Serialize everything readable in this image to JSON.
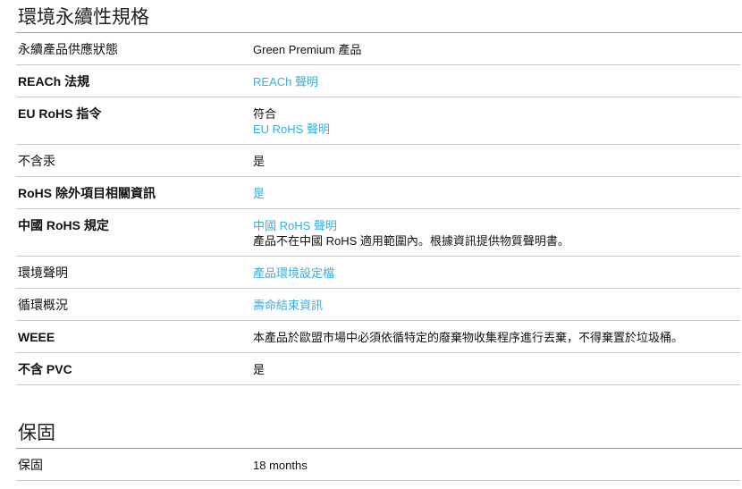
{
  "sections": {
    "sustainability": {
      "title": "環境永續性規格",
      "rows": {
        "green_premium": {
          "label": "永續產品供應狀態",
          "value": "Green Premium 產品"
        },
        "reach": {
          "label": "REACh 法規",
          "link": "REACh 聲明"
        },
        "rohs": {
          "label": "EU RoHS 指令",
          "value": "符合",
          "link": "EU RoHS 聲明"
        },
        "mercury": {
          "label": "不含汞",
          "value": "是"
        },
        "rohs_exemption": {
          "label": "RoHS 除外項目相關資訊",
          "link": "是"
        },
        "china_rohs": {
          "label": "中國 RoHS 規定",
          "link": "中國 RoHS 聲明",
          "value": "產品不在中國 RoHS 適用範圍內。根據資訊提供物質聲明書。"
        },
        "env_disclosure": {
          "label": "環境聲明",
          "link": "產品環境設定檔"
        },
        "circularity": {
          "label": "循環概況",
          "link": "壽命結束資訊"
        },
        "weee": {
          "label": "WEEE",
          "value": "本產品於歐盟市場中必須依循特定的廢棄物收集程序進行丟棄，不得棄置於垃圾桶。"
        },
        "pvc": {
          "label": "不含 PVC",
          "value": "是"
        }
      }
    },
    "warranty": {
      "title": "保固",
      "rows": {
        "warranty": {
          "label": "保固",
          "value": "18 months"
        }
      }
    }
  }
}
